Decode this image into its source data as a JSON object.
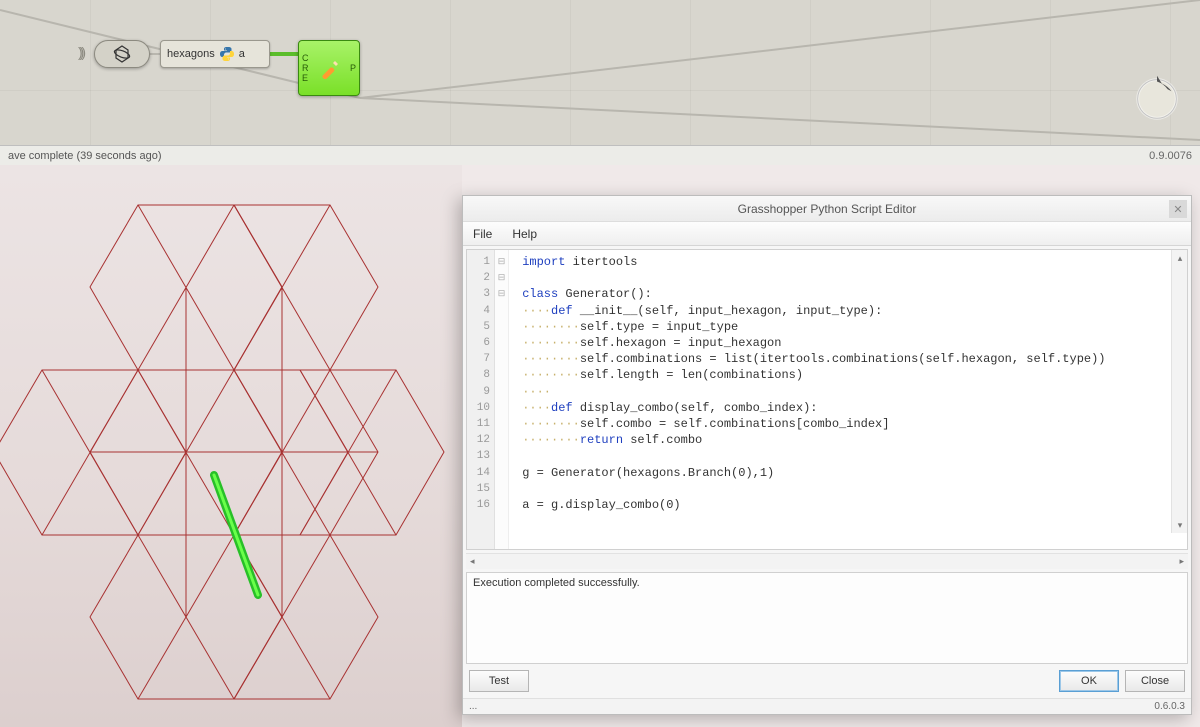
{
  "canvas": {
    "param_icon": "hexagon-grid",
    "python_label": "hexagons",
    "python_out": "a",
    "lb_inputs": [
      "C",
      "R",
      "E"
    ],
    "lb_outputs": [
      "P"
    ]
  },
  "top_status": {
    "left": "ave complete (39 seconds ago)",
    "right": "0.9.0076"
  },
  "editor": {
    "title": "Grasshopper Python Script Editor",
    "menu": {
      "file": "File",
      "help": "Help"
    },
    "line_numbers": [
      "1",
      "2",
      "3",
      "4",
      "5",
      "6",
      "7",
      "8",
      "9",
      "10",
      "11",
      "12",
      "13",
      "14",
      "15",
      "16"
    ],
    "fold_marks": [
      "",
      "",
      "⊟",
      "⊟",
      "",
      "",
      "",
      "",
      "",
      "⊟",
      "",
      "",
      "",
      "",
      "",
      ""
    ],
    "code": {
      "l1": {
        "kw": "import",
        "rest": " itertools"
      },
      "l3": {
        "kw": "class",
        "rest": " Generator():"
      },
      "l4": {
        "dots": "····",
        "kw": "def",
        "rest": " __init__(self, input_hexagon, input_type):"
      },
      "l5": {
        "dots": "········",
        "rest": "self.type = input_type"
      },
      "l6": {
        "dots": "········",
        "rest": "self.hexagon = input_hexagon"
      },
      "l7": {
        "dots": "········",
        "rest": "self.combinations = list(itertools.combinations(self.hexagon, self.type))"
      },
      "l8": {
        "dots": "········",
        "rest": "self.length = len(combinations)"
      },
      "l9": {
        "dots": "····"
      },
      "l10": {
        "dots": "····",
        "kw": "def",
        "rest": " display_combo(self, combo_index):"
      },
      "l11": {
        "dots": "········",
        "rest": "self.combo = self.combinations[combo_index]"
      },
      "l12": {
        "dots": "········",
        "kw": "return",
        "rest": " self.combo"
      },
      "l14": {
        "rest": "g = Generator(hexagons.Branch(0),1)"
      },
      "l16": {
        "rest": "a = g.display_combo(0)"
      }
    },
    "output": "Execution completed successfully.",
    "buttons": {
      "test": "Test",
      "ok": "OK",
      "close": "Close"
    },
    "status_left": "...",
    "status_right": "0.6.0.3"
  }
}
